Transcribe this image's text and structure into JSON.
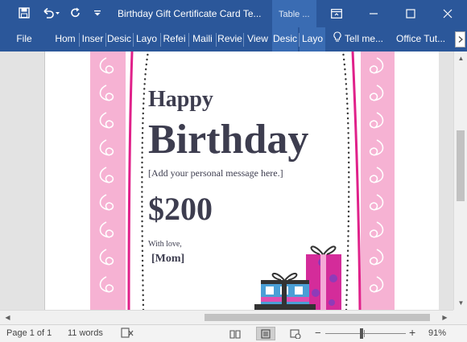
{
  "window": {
    "title": "Birthday Gift Certificate Card Te...",
    "context_tab": "Table ...",
    "colors": {
      "titlebar": "#2b579a",
      "context": "#3a6cb3",
      "card_pink": "#f6b2d3",
      "card_magenta": "#e0218a"
    }
  },
  "quick_access": {
    "save_icon": "save-icon",
    "undo_icon": "undo-icon",
    "redo_icon": "redo-icon",
    "customize_icon": "customize-icon"
  },
  "window_controls": {
    "ribbon_display_icon": "ribbon-display-icon",
    "minimize_icon": "minimize-icon",
    "maximize_icon": "maximize-icon",
    "close_icon": "close-icon"
  },
  "ribbon": {
    "tabs": [
      {
        "label": "File"
      },
      {
        "label": "Hom"
      },
      {
        "label": "Inser"
      },
      {
        "label": "Desic"
      },
      {
        "label": "Layo"
      },
      {
        "label": "Refei"
      },
      {
        "label": "Maili"
      },
      {
        "label": "Revie"
      },
      {
        "label": "View"
      },
      {
        "label": "Desic"
      },
      {
        "label": "Layo"
      }
    ],
    "tell_me": "Tell me...",
    "office_tutorial": "Office Tut...",
    "scroll_icon": "chevron-right-icon"
  },
  "card": {
    "happy": "Happy",
    "birthday": "Birthday",
    "message": "[Add your personal message here.]",
    "amount": "$200",
    "with_love": "With love,",
    "from": "[Mom]"
  },
  "status": {
    "page": "Page 1 of 1",
    "words": "11 words",
    "proofing_icon": "proofing-icon",
    "views": [
      "read-mode-icon",
      "print-layout-icon",
      "web-layout-icon"
    ],
    "zoom_minus": "−",
    "zoom_plus": "+",
    "zoom_level": "91%",
    "zoom_percent": 91
  }
}
